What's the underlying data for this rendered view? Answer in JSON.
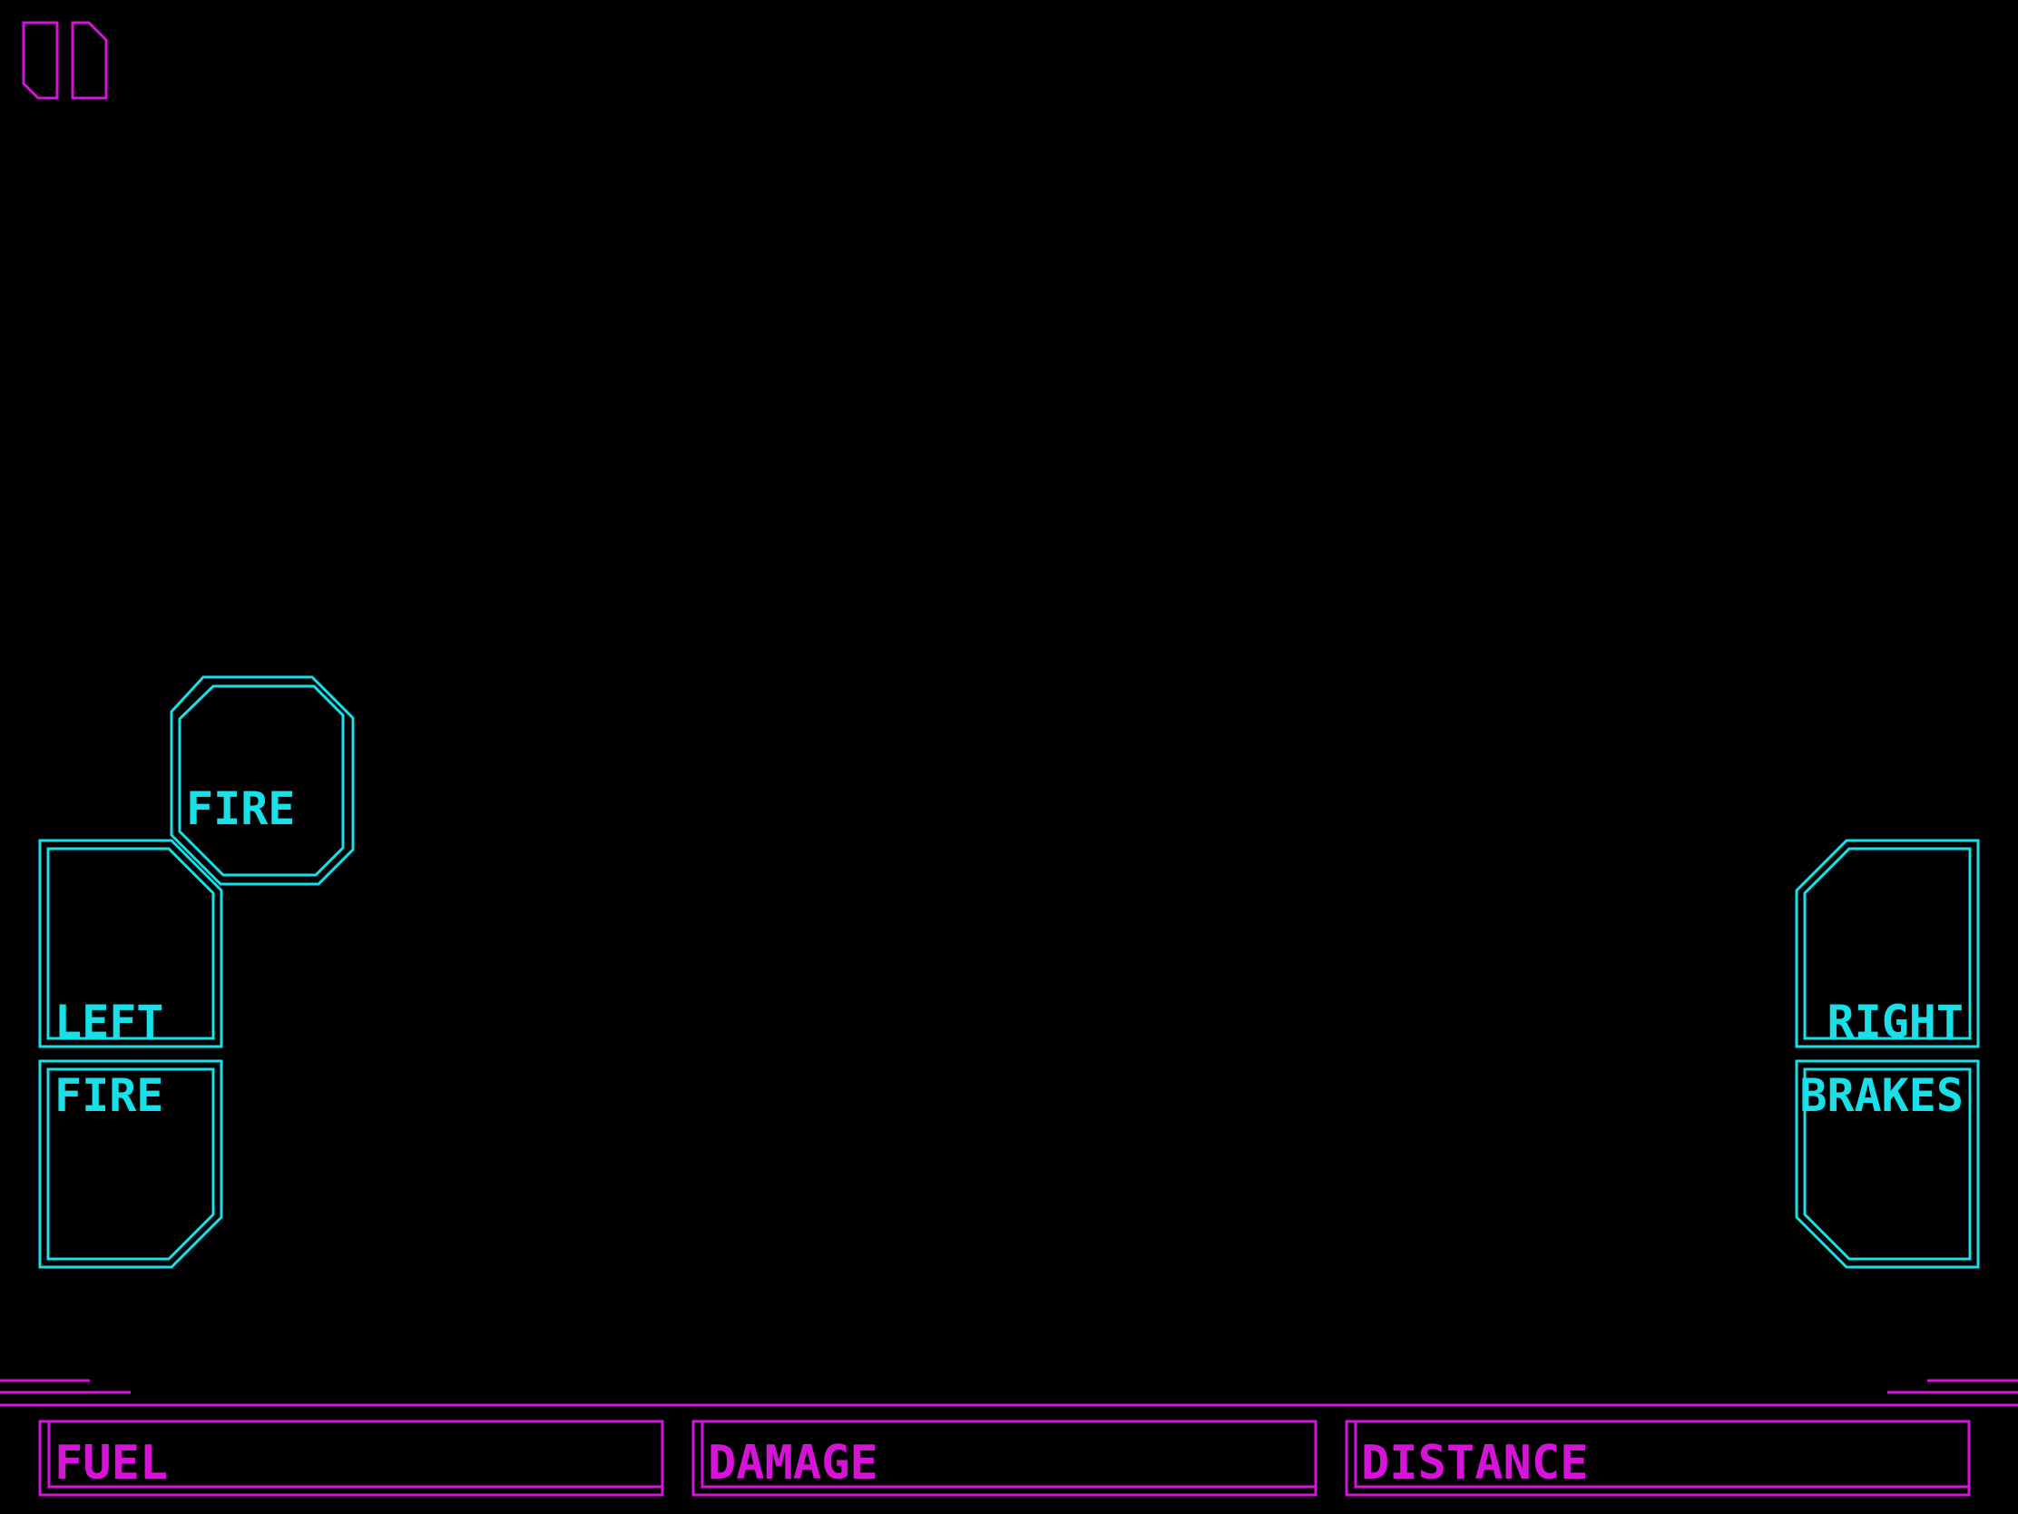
{
  "colors": {
    "controls": "#17e0e8",
    "hud": "#d614d8",
    "background": "#000000"
  },
  "pause": {
    "icon": "pause-icon"
  },
  "controls": {
    "fire_top": "FIRE",
    "left": "LEFT",
    "fire_bottom": "FIRE",
    "right": "RIGHT",
    "brakes": "BRAKES"
  },
  "gauges": {
    "fuel": "FUEL",
    "damage": "DAMAGE",
    "distance": "DISTANCE"
  }
}
